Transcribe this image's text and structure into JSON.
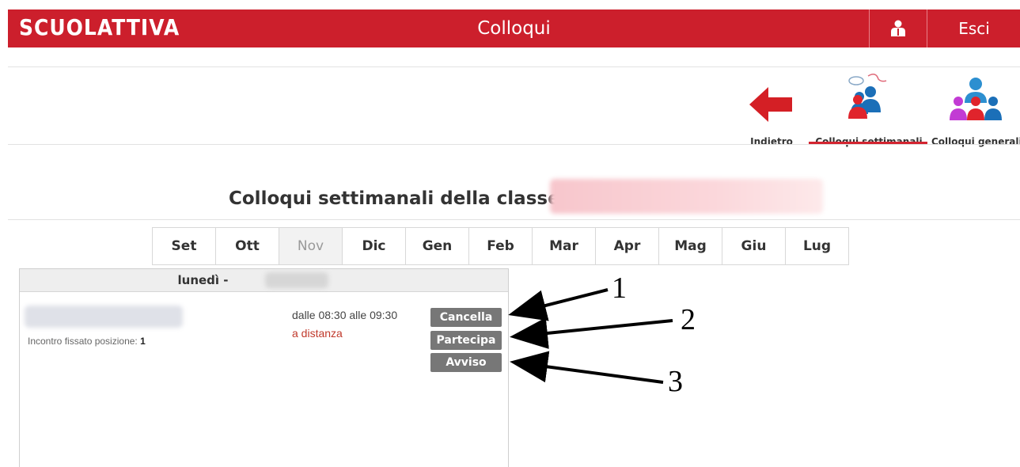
{
  "header": {
    "brand": "SCUOLATTIVA",
    "title": "Colloqui",
    "logout_label": "Esci",
    "bar_color": "#cc1f2c"
  },
  "nav": {
    "back_label": "Indietro",
    "weekly_label": "Colloqui settimanali",
    "general_label": "Colloqui generali"
  },
  "section": {
    "heading": "Colloqui settimanali della classe"
  },
  "months": [
    "Set",
    "Ott",
    "Nov",
    "Dic",
    "Gen",
    "Feb",
    "Mar",
    "Apr",
    "Mag",
    "Giu",
    "Lug"
  ],
  "months_disabled": [
    "Nov"
  ],
  "day": {
    "label": "lunedì -"
  },
  "meeting": {
    "position_label": "Incontro fissato posizione:",
    "position_value": "1",
    "time": "dalle 08:30 alle 09:30",
    "mode": "a distanza"
  },
  "actions": {
    "cancel": "Cancella",
    "join": "Partecipa",
    "notice": "Avviso"
  },
  "annotations": {
    "n1": "1",
    "n2": "2",
    "n3": "3"
  },
  "icons": {
    "user": "user-icon",
    "back": "back-arrow-icon",
    "weekly": "weekly-meetings-icon",
    "general": "general-meetings-icon"
  }
}
